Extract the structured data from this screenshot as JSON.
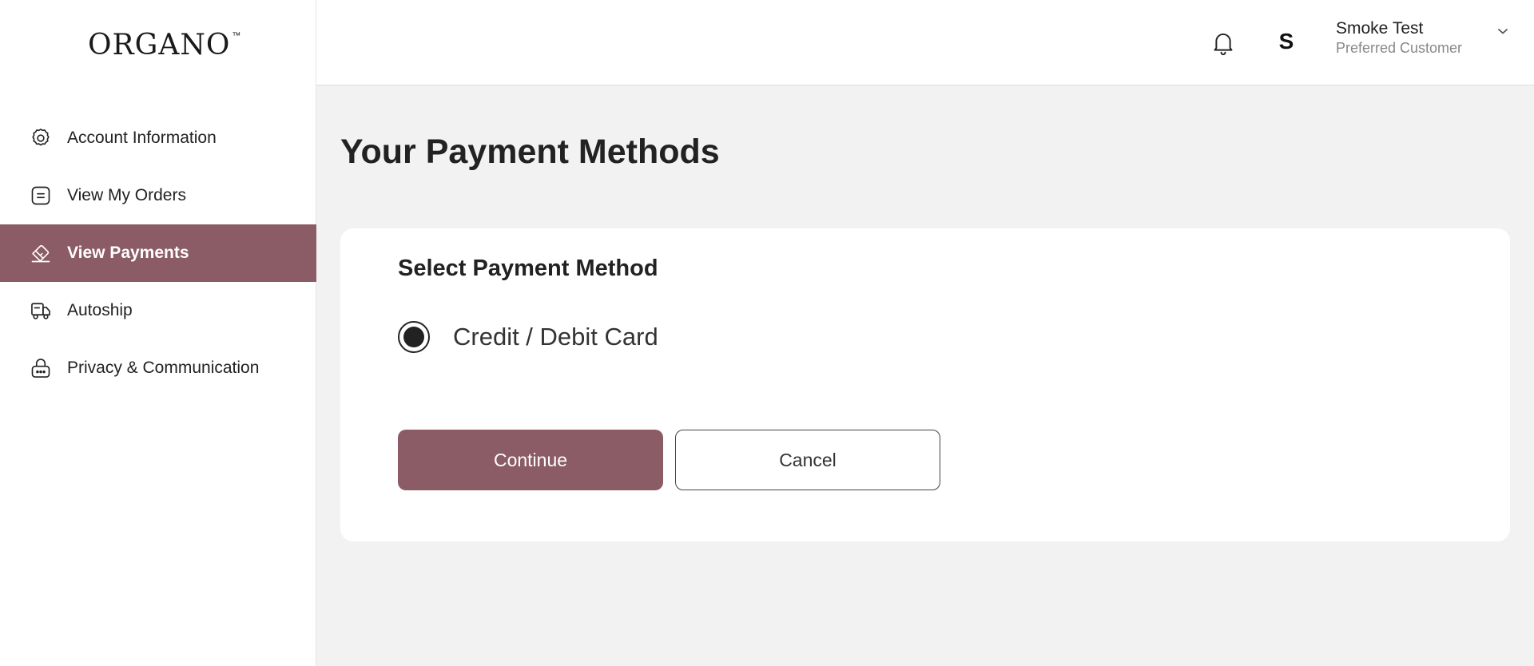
{
  "brand": {
    "logo_text": "ORGANO",
    "logo_mark": "™",
    "accent_color": "#8b5c65"
  },
  "sidebar": {
    "items": [
      {
        "label": "Account Information",
        "icon": "gear-icon",
        "active": false
      },
      {
        "label": "View My Orders",
        "icon": "orders-icon",
        "active": false
      },
      {
        "label": "View Payments",
        "icon": "payment-icon",
        "active": true
      },
      {
        "label": "Autoship",
        "icon": "truck-icon",
        "active": false
      },
      {
        "label": "Privacy & Communication",
        "icon": "lock-icon",
        "active": false
      }
    ]
  },
  "header": {
    "avatar_initial": "S",
    "user_name": "Smoke Test",
    "user_role": "Preferred Customer"
  },
  "main": {
    "title": "Your Payment Methods",
    "card": {
      "title": "Select Payment Method",
      "options": [
        {
          "label": "Credit / Debit Card",
          "selected": true
        }
      ],
      "continue_label": "Continue",
      "cancel_label": "Cancel"
    }
  }
}
